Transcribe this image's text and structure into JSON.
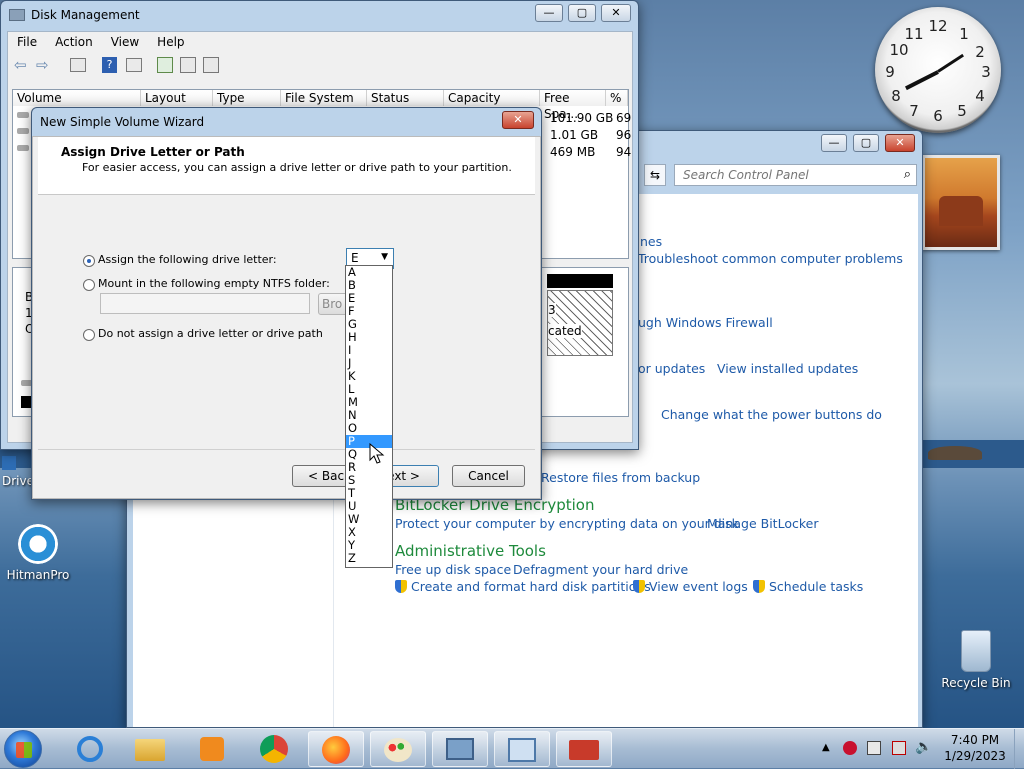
{
  "desktop": {
    "icons": [
      {
        "label": "HitmanPro"
      },
      {
        "label": "Drive"
      },
      {
        "label": "Recycle Bin"
      }
    ]
  },
  "clock": {
    "numerals": [
      "12",
      "1",
      "2",
      "3",
      "4",
      "5",
      "6",
      "7",
      "8",
      "9",
      "10",
      "11"
    ]
  },
  "disk_mgmt": {
    "title": "Disk Management",
    "menu": [
      "File",
      "Action",
      "View",
      "Help"
    ],
    "columns": [
      "Volume",
      "Layout",
      "Type",
      "File System",
      "Status",
      "Capacity",
      "Free Spa...",
      "%"
    ],
    "free_space": [
      "101.90 GB",
      "1.01 GB",
      "469 MB"
    ],
    "pct": [
      "69",
      "96",
      "94"
    ],
    "left_labels": [
      "B",
      "1",
      "O"
    ],
    "unalloc_partial": "cated",
    "unalloc_num": "3"
  },
  "wizard": {
    "title": "New Simple Volume Wizard",
    "heading": "Assign Drive Letter or Path",
    "subtitle": "For easier access, you can assign a drive letter or drive path to your partition.",
    "option_assign": "Assign the following drive letter:",
    "option_mount": "Mount in the following empty NTFS folder:",
    "option_none": "Do not assign a drive letter or drive path",
    "browse_partial": "Bro",
    "selected_letter": "E",
    "letters": [
      "A",
      "B",
      "E",
      "F",
      "G",
      "H",
      "I",
      "J",
      "K",
      "L",
      "M",
      "N",
      "O",
      "P",
      "Q",
      "R",
      "S",
      "T",
      "U",
      "W",
      "X",
      "Y",
      "Z"
    ],
    "highlighted": "P",
    "back_label": "< Back",
    "next_label": "ext >",
    "cancel_label": "Cancel"
  },
  "control_panel": {
    "search_placeholder": "Search Control Panel",
    "links": {
      "l1": "nes",
      "l2": "Troubleshoot common computer problems",
      "l3": "ugh Windows Firewall",
      "l4": "or updates",
      "l5": "View installed updates",
      "l6": "Change what the power buttons do",
      "l7": "Restore files from backup",
      "bitlocker_head": "BitLocker Drive Encryption",
      "bitlocker_1": "Protect your computer by encrypting data on your disk",
      "bitlocker_2": "Manage BitLocker",
      "admin_head": "Administrative Tools",
      "admin_1": "Free up disk space",
      "admin_2": "Defragment your hard drive",
      "admin_3": "Create and format hard disk partitions",
      "admin_4": "View event logs",
      "admin_5": "Schedule tasks"
    }
  },
  "taskbar": {
    "time": "7:40 PM",
    "date": "1/29/2023"
  }
}
